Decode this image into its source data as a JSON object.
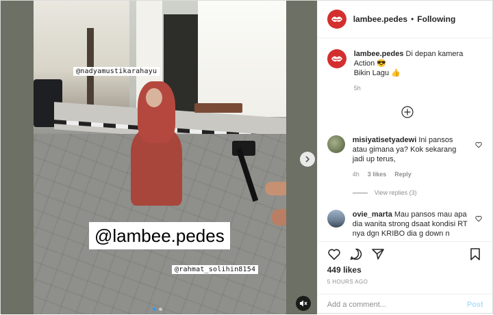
{
  "post": {
    "username": "lambee.pedes",
    "follow_label": "Following",
    "separator": "•"
  },
  "caption": {
    "username": "lambee.pedes",
    "text_line1": " Di depan kamera Action 😎",
    "text_line2": "Bikin Lagu 👍",
    "time": "5h"
  },
  "media": {
    "tag_top": "@nadyamustikarahayu",
    "tag_bottom": "@rahmat_solihin8154",
    "watermark": "@lambee.pedes",
    "carousel_dots": 2,
    "active_dot": 0
  },
  "comments": [
    {
      "username": "misiyatisetyadewi",
      "text": " Ini pansos atau gimana ya? Kok sekarang jadi up terus,",
      "time": "4h",
      "likes_label": "3 likes",
      "reply_label": "Reply",
      "view_replies": "View replies (3)"
    },
    {
      "username": "ovie_marta",
      "text": " Mau pansos mau apa dia wanita strong dsaat kondisi RT nya dgn KRIBO dia g down n"
    }
  ],
  "actions": {
    "likes": "449 likes",
    "time": "5 HOURS AGO",
    "add_comment_placeholder": "Add a comment...",
    "post_label": "Post"
  },
  "colors": {
    "brand_red": "#d32f2f",
    "link_blue": "#3897f0",
    "post_button_disabled": "#b2dffc",
    "secondary_text": "#8e8e8e"
  },
  "icons": [
    "heart-icon",
    "comment-icon",
    "share-icon",
    "bookmark-icon",
    "add-circle-icon",
    "chevron-right-icon",
    "mute-icon"
  ]
}
